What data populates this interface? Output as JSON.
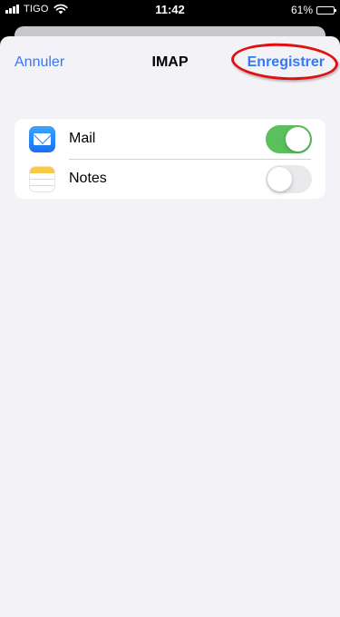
{
  "status_bar": {
    "carrier": "TIGO",
    "time": "11:42",
    "battery": "61%",
    "battery_level": 0.61,
    "icons": [
      "signal-icon",
      "wifi-icon",
      "battery-icon"
    ]
  },
  "navbar": {
    "cancel_label": "Annuler",
    "title": "IMAP",
    "save_label": "Enregistrer"
  },
  "colors": {
    "accent": "#3478f6",
    "switch_on": "#5ac05e",
    "annotation_ring": "#e01010",
    "background": "#f2f2f7"
  },
  "settings": {
    "items": [
      {
        "label": "Mail",
        "icon": "mail-icon",
        "enabled": true
      },
      {
        "label": "Notes",
        "icon": "notes-icon",
        "enabled": false
      }
    ]
  }
}
